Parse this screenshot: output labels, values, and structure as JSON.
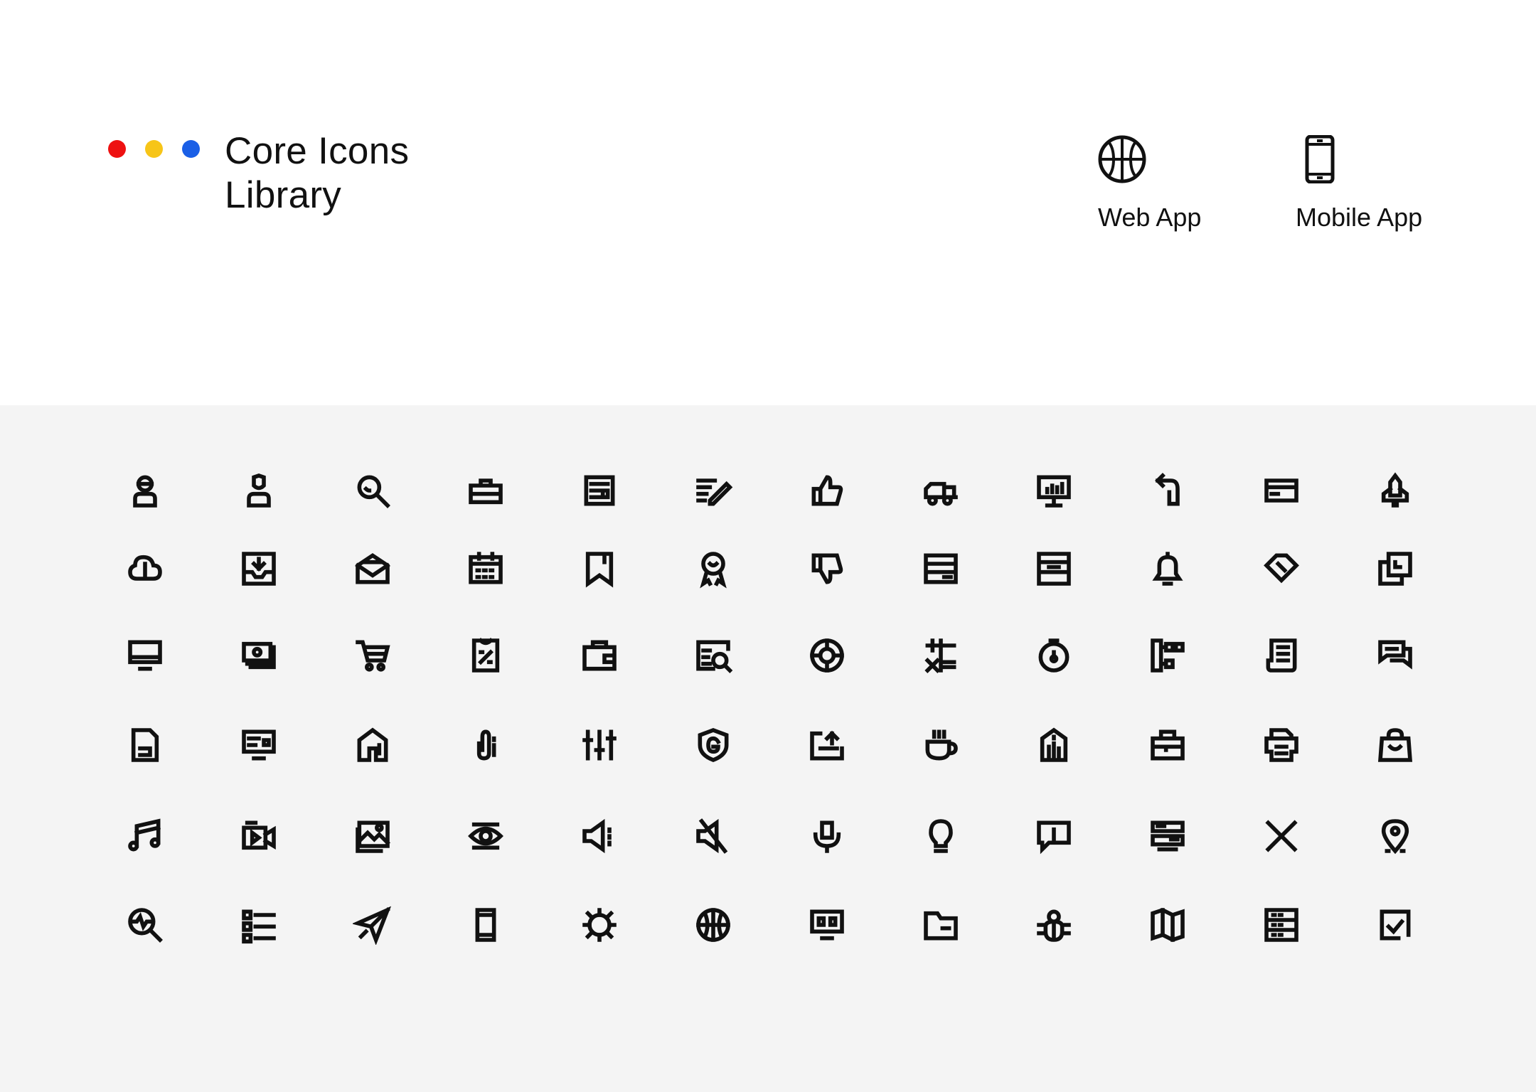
{
  "colors": {
    "dot_red": "#ee1111",
    "dot_yellow": "#f7c518",
    "dot_blue": "#1a5fe6",
    "panel_bg": "#f4f4f4",
    "ink": "#111111"
  },
  "header": {
    "title_line1": "Core Icons",
    "title_line2": "Library",
    "platforms": [
      {
        "label": "Web App",
        "icon": "globe-icon"
      },
      {
        "label": "Mobile App",
        "icon": "smartphone-icon"
      }
    ]
  },
  "icon_grid": {
    "rows": [
      [
        "user-headset-icon",
        "user-shield-icon",
        "search-icon",
        "briefcase-icon",
        "newspaper-icon",
        "edit-list-icon",
        "thumbs-up-icon",
        "delivery-truck-icon",
        "presentation-chart-icon",
        "return-arrow-icon",
        "credit-card-icon",
        "rocket-icon"
      ],
      [
        "cloud-info-icon",
        "inbox-download-icon",
        "open-envelope-icon",
        "calendar-icon",
        "bookmark-icon",
        "award-badge-icon",
        "thumbs-down-icon",
        "server-list-icon",
        "archive-box-icon",
        "notification-bell-icon",
        "price-tag-icon",
        "copy-layers-icon"
      ],
      [
        "monitor-icon",
        "money-cash-icon",
        "shopping-cart-icon",
        "discount-receipt-icon",
        "wallet-icon",
        "search-document-icon",
        "lifebuoy-icon",
        "calculator-icon",
        "stopwatch-icon",
        "hierarchy-icon",
        "document-list-icon",
        "chat-bubbles-icon"
      ],
      [
        "file-icon",
        "monitor-settings-icon",
        "home-icon",
        "paperclip-icon",
        "equalizer-sliders-icon",
        "security-shield-icon",
        "upload-tray-icon",
        "coffee-cup-icon",
        "building-icon",
        "toolbox-icon",
        "printer-icon",
        "shopping-bag-icon"
      ],
      [
        "music-note-icon",
        "video-camera-icon",
        "image-gallery-icon",
        "eye-view-icon",
        "speaker-volume-icon",
        "speaker-mute-icon",
        "microphone-icon",
        "lightbulb-icon",
        "message-info-icon",
        "server-rack-icon",
        "close-icon",
        "map-pin-icon"
      ],
      [
        "analytics-search-icon",
        "checklist-icon",
        "paper-plane-icon",
        "mobile-phone-icon",
        "gear-icon",
        "globe-icon",
        "dashboard-monitor-icon",
        "folder-icon",
        "bug-icon",
        "map-icon",
        "data-storage-icon",
        "task-checkbox-icon"
      ]
    ]
  }
}
